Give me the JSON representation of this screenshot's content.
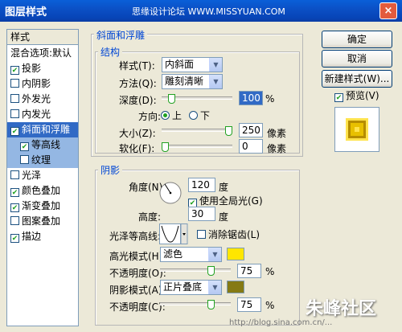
{
  "window": {
    "title": "图层样式",
    "site_text": "思缘设计论坛 WWW.MISSYUAN.COM",
    "close": "×"
  },
  "style_list": {
    "header": "样式",
    "items": [
      {
        "label": "混合选项:默认",
        "checkbox": false,
        "checked": false,
        "state": "normal"
      },
      {
        "label": "投影",
        "checkbox": true,
        "checked": true,
        "state": "normal"
      },
      {
        "label": "内阴影",
        "checkbox": true,
        "checked": false,
        "state": "normal"
      },
      {
        "label": "外发光",
        "checkbox": true,
        "checked": false,
        "state": "normal"
      },
      {
        "label": "内发光",
        "checkbox": true,
        "checked": false,
        "state": "normal"
      },
      {
        "label": "斜面和浮雕",
        "checkbox": true,
        "checked": true,
        "state": "selected"
      },
      {
        "label": "等高线",
        "checkbox": true,
        "checked": true,
        "state": "sub"
      },
      {
        "label": "纹理",
        "checkbox": true,
        "checked": false,
        "state": "sub"
      },
      {
        "label": "光泽",
        "checkbox": true,
        "checked": false,
        "state": "normal"
      },
      {
        "label": "颜色叠加",
        "checkbox": true,
        "checked": true,
        "state": "normal"
      },
      {
        "label": "渐变叠加",
        "checkbox": true,
        "checked": true,
        "state": "normal"
      },
      {
        "label": "图案叠加",
        "checkbox": true,
        "checked": false,
        "state": "normal"
      },
      {
        "label": "描边",
        "checkbox": true,
        "checked": true,
        "state": "normal"
      }
    ]
  },
  "bevel": {
    "group_title": "斜面和浮雕",
    "structure_title": "结构",
    "style_label": "样式(T):",
    "style_value": "内斜面",
    "method_label": "方法(Q):",
    "method_value": "雕刻清晰",
    "depth_label": "深度(D):",
    "depth_value": "100",
    "depth_unit": "%",
    "depth_level": 0.1,
    "direction_label": "方向:",
    "dir_up": "上",
    "dir_down": "下",
    "size_label": "大小(Z):",
    "size_value": "250",
    "size_unit": "像素",
    "size_level": 1.0,
    "soften_label": "软化(F):",
    "soften_value": "0",
    "soften_unit": "像素",
    "soften_level": 0.0
  },
  "shading": {
    "group_title": "阴影",
    "angle_label": "角度(N):",
    "angle_value": "120",
    "angle_unit": "度",
    "global_light_label": "使用全局光(G)",
    "altitude_label": "高度:",
    "altitude_value": "30",
    "altitude_unit": "度",
    "gloss_label": "光泽等高线:",
    "antialias_label": "消除锯齿(L)",
    "highlight_label": "高光模式(H):",
    "highlight_value": "滤色",
    "highlight_color": "#ffe600",
    "highlight_opacity_label": "不透明度(O):",
    "highlight_opacity": "75",
    "highlight_opacity_level": 0.75,
    "shadow_label": "阴影模式(A):",
    "shadow_value": "正片叠底",
    "shadow_color": "#857a14",
    "shadow_opacity_label": "不透明度(C):",
    "shadow_opacity": "75",
    "shadow_opacity_level": 0.75,
    "opacity_unit": "%"
  },
  "buttons": {
    "ok": "确定",
    "cancel": "取消",
    "new_style": "新建样式(W)...",
    "preview": "预览(V)"
  },
  "watermark": {
    "brand": "朱峰社区",
    "url": "http://blog.sina.com.cn/..."
  }
}
